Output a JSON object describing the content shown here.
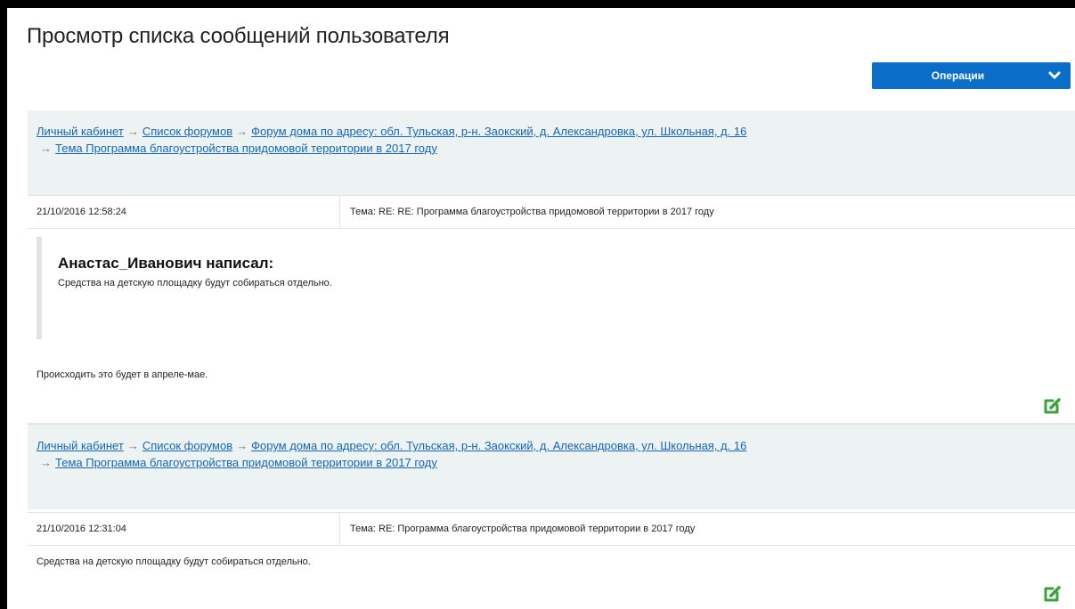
{
  "page": {
    "title": "Просмотр списка сообщений пользователя"
  },
  "operations": {
    "label": "Операции"
  },
  "breadcrumb": {
    "cabinet": "Личный кабинет",
    "forums": "Список форумов",
    "forum": "Форум дома по адресу: обл. Тульская, р-н. Заокский, д. Александровка, ул. Школьная, д. 16",
    "topic": "Тема Программа благоустройства придомовой территории в 2017 году",
    "arrow": "→"
  },
  "messages": [
    {
      "date": "21/10/2016 12:58:24",
      "topic": "Тема: RE: RE: Программа благоустройства придомовой территории в 2017 году",
      "quote_author": "Анастас_Иванович написал:",
      "quote_text": "Средства на детскую площадку будут собираться отдельно.",
      "text": "Происходить это будет в апреле-мае."
    },
    {
      "date": "21/10/2016 12:31:04",
      "topic": "Тема: RE: Программа благоустройства придомовой территории в 2017 году",
      "text": "Средства на детскую площадку будут собираться отдельно."
    }
  ],
  "colors": {
    "accent": "#0a6ec9",
    "link": "#1566b5",
    "edit_icon": "#3aa339",
    "crumb_bg": "#edf3f3"
  },
  "icons": {
    "operations": "chevron-down-icon",
    "edit": "edit-icon"
  }
}
